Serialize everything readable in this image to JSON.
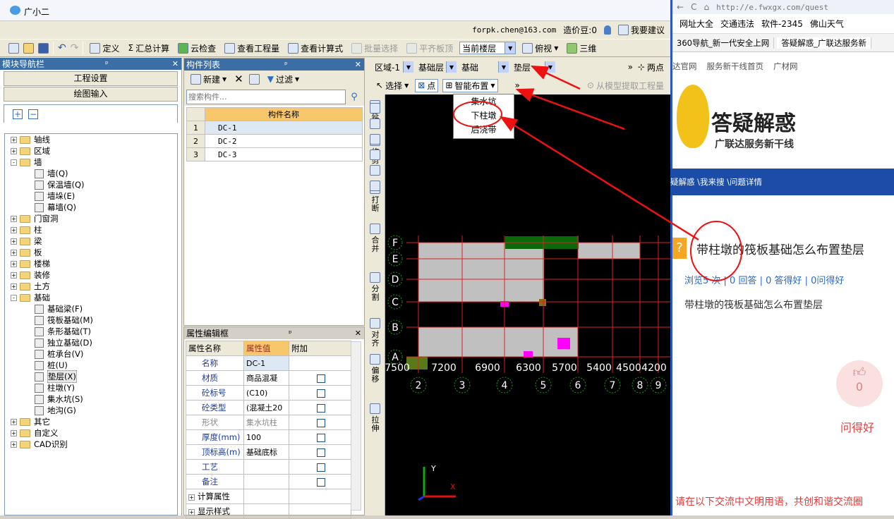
{
  "app": {
    "title": "广小二",
    "user": "forpk.chen@163.com",
    "price_bean": "造价豆:0",
    "suggest": "我要建议"
  },
  "toolbar": {
    "define": "定义",
    "sum": "汇总计算",
    "cloud_check": "云检查",
    "view_quantity": "查看工程量",
    "view_formula": "查看计算式",
    "batch_select": "批量选择",
    "flat_top": "平齐板顶",
    "floor": "当前楼层",
    "view_mode": "俯视",
    "three_d": "三维"
  },
  "nav": {
    "title": "模块导航栏",
    "project_settings": "工程设置",
    "drawing_input": "绘图输入",
    "tree": [
      {
        "label": "轴线",
        "level": 0,
        "exp": "+",
        "type": "folder"
      },
      {
        "label": "区域",
        "level": 0,
        "exp": "+",
        "type": "folder"
      },
      {
        "label": "墙",
        "level": 0,
        "exp": "-",
        "type": "folder"
      },
      {
        "label": "墙(Q)",
        "level": 1,
        "type": "leaf"
      },
      {
        "label": "保温墙(Q)",
        "level": 1,
        "type": "leaf"
      },
      {
        "label": "墙垛(E)",
        "level": 1,
        "type": "leaf"
      },
      {
        "label": "幕墙(Q)",
        "level": 1,
        "type": "leaf"
      },
      {
        "label": "门窗洞",
        "level": 0,
        "exp": "+",
        "type": "folder"
      },
      {
        "label": "柱",
        "level": 0,
        "exp": "+",
        "type": "folder"
      },
      {
        "label": "梁",
        "level": 0,
        "exp": "+",
        "type": "folder"
      },
      {
        "label": "板",
        "level": 0,
        "exp": "+",
        "type": "folder"
      },
      {
        "label": "楼梯",
        "level": 0,
        "exp": "+",
        "type": "folder"
      },
      {
        "label": "装修",
        "level": 0,
        "exp": "+",
        "type": "folder"
      },
      {
        "label": "土方",
        "level": 0,
        "exp": "+",
        "type": "folder"
      },
      {
        "label": "基础",
        "level": 0,
        "exp": "-",
        "type": "folder"
      },
      {
        "label": "基础梁(F)",
        "level": 1,
        "type": "leaf"
      },
      {
        "label": "筏板基础(M)",
        "level": 1,
        "type": "leaf"
      },
      {
        "label": "条形基础(T)",
        "level": 1,
        "type": "leaf"
      },
      {
        "label": "独立基础(D)",
        "level": 1,
        "type": "leaf"
      },
      {
        "label": "桩承台(V)",
        "level": 1,
        "type": "leaf"
      },
      {
        "label": "桩(U)",
        "level": 1,
        "type": "leaf"
      },
      {
        "label": "垫层(X)",
        "level": 1,
        "type": "leaf",
        "selected": true
      },
      {
        "label": "柱墩(Y)",
        "level": 1,
        "type": "leaf"
      },
      {
        "label": "集水坑(S)",
        "level": 1,
        "type": "leaf"
      },
      {
        "label": "地沟(G)",
        "level": 1,
        "type": "leaf"
      },
      {
        "label": "其它",
        "level": 0,
        "exp": "+",
        "type": "folder"
      },
      {
        "label": "自定义",
        "level": 0,
        "exp": "+",
        "type": "folder"
      },
      {
        "label": "CAD识别",
        "level": 0,
        "exp": "+",
        "type": "folder"
      }
    ]
  },
  "complist": {
    "title": "构件列表",
    "new": "新建",
    "filter": "过滤",
    "search_placeholder": "搜索构件...",
    "col_name": "构件名称",
    "rows": [
      {
        "n": "1",
        "name": "DC-1"
      },
      {
        "n": "2",
        "name": "DC-2"
      },
      {
        "n": "3",
        "name": "DC-3"
      }
    ]
  },
  "props": {
    "title": "属性编辑框",
    "col_name": "属性名称",
    "col_value": "属性值",
    "col_extra": "附加",
    "rows": [
      {
        "name": "名称",
        "value": "DC-1",
        "cb": false
      },
      {
        "name": "材质",
        "value": "商品混凝",
        "cb": true
      },
      {
        "name": "砼标号",
        "value": "(C10)",
        "cb": true
      },
      {
        "name": "砼类型",
        "value": "(混凝土20",
        "cb": true
      },
      {
        "name": "形状",
        "value": "集水坑柱",
        "cb": true,
        "disabled": true
      },
      {
        "name": "厚度(mm)",
        "value": "100",
        "cb": true
      },
      {
        "name": "顶标高(m)",
        "value": "基础底标",
        "cb": true
      },
      {
        "name": "工艺",
        "value": "",
        "cb": true
      },
      {
        "name": "备注",
        "value": "",
        "cb": true
      },
      {
        "name": "计算属性",
        "value": "",
        "group": true
      },
      {
        "name": "显示样式",
        "value": "",
        "group": true
      }
    ]
  },
  "canvas_bar": {
    "zone": "区域-1",
    "layer": "基础层",
    "category": "基础",
    "component": "垫层",
    "two_points": "两点",
    "select": "选择",
    "point": "点",
    "smart_place": "智能布置",
    "extract": "从模型提取工程量"
  },
  "dropdown": {
    "items": [
      "集水坑",
      "下柱墩",
      "后浇带"
    ]
  },
  "vtools": [
    "延伸",
    "修剪",
    "打断",
    "合并",
    "分割",
    "对齐",
    "偏移",
    "拉伸"
  ],
  "grid": {
    "row_labels": [
      "F",
      "E",
      "D",
      "C",
      "B",
      "A"
    ],
    "col_labels": [
      "2",
      "3",
      "4",
      "5",
      "6",
      "7",
      "8",
      "9"
    ],
    "dims": [
      "7500",
      "7200",
      "6900",
      "6300",
      "5700",
      "5400",
      "4500",
      "4200"
    ],
    "axis_y": "Y",
    "axis_x": "X"
  },
  "browser": {
    "url": "http://e.fwxgx.com/quest",
    "bookmarks": [
      "网址大全",
      "交通违法",
      "软件-2345",
      "佛山天气"
    ],
    "tabs": [
      "360导航_新一代安全上网",
      "答疑解惑_广联达服务新"
    ],
    "nav_links": [
      "达官网",
      "服务新干线首页",
      "广材网"
    ],
    "brand": "答疑解惑",
    "brand_sub": "广联达服务新干线",
    "breadcrumb": "疑解惑 \\我来搜 \\问题详情",
    "question": "带柱墩的筏板基础怎么布置垫层",
    "stats": "浏览5 次 | 0 回答 | 0 答得好 | 0问得好",
    "question_body": "带柱墩的筏板基础怎么布置垫层",
    "like_count": "0",
    "like_label": "问得好",
    "footer_note": "请在以下交流中文明用语，共创和谐交流圈"
  }
}
